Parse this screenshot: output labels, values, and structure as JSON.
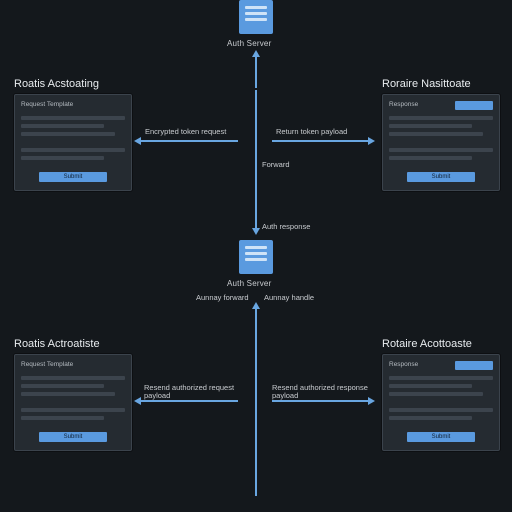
{
  "servers": {
    "top": {
      "caption": "Auth Server"
    },
    "bottom": {
      "caption": "Auth Server"
    }
  },
  "cards": {
    "tl": {
      "title": "Roatis Acstoating",
      "header": "Request Template",
      "button": "Submit"
    },
    "tr": {
      "title": "Roraire Nasittoate",
      "header": "Response",
      "button": "Submit"
    },
    "bl": {
      "title": "Roatis Actroatiste",
      "header": "Request Template",
      "button": "Submit"
    },
    "br": {
      "title": "Rotaire Acottoaste",
      "header": "Response",
      "button": "Submit"
    }
  },
  "labels": {
    "top_left_arrow": "Encrypted token request",
    "top_right_arrow": "Return token payload",
    "top_down": "Forward",
    "mid_top": "Auth response",
    "mid_left": "Aunnay forward",
    "mid_right": "Aunnay handle",
    "bot_left_arrow": "Resend authorized request payload",
    "bot_right_arrow": "Resend authorized response payload"
  }
}
